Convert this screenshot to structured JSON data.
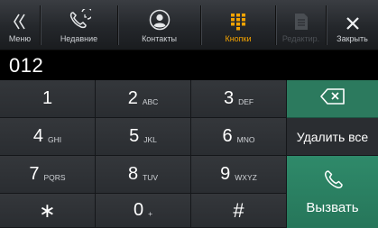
{
  "topbar": {
    "menu_label": "Меню",
    "recent_label": "Недавние",
    "contacts_label": "Контакты",
    "keypad_label": "Кнопки",
    "edit_label": "Редактир.",
    "close_label": "Закрыть",
    "active_color": "#f4a300"
  },
  "display": {
    "number": "012"
  },
  "keypad": {
    "keys": [
      {
        "digit": "1",
        "letters": ""
      },
      {
        "digit": "2",
        "letters": "ABC"
      },
      {
        "digit": "3",
        "letters": "DEF"
      },
      {
        "digit": "4",
        "letters": "GHI"
      },
      {
        "digit": "5",
        "letters": "JKL"
      },
      {
        "digit": "6",
        "letters": "MNO"
      },
      {
        "digit": "7",
        "letters": "PQRS"
      },
      {
        "digit": "8",
        "letters": "TUV"
      },
      {
        "digit": "9",
        "letters": "WXYZ"
      },
      {
        "digit": "∗",
        "letters": ""
      },
      {
        "digit": "0",
        "letters": "+"
      },
      {
        "digit": "#",
        "letters": ""
      }
    ]
  },
  "actions": {
    "delete_all_label": "Удалить все",
    "call_label": "Вызвать",
    "accent_color": "#2c7a5e"
  },
  "icons": {
    "menu": "chevron-double-left-icon",
    "recent": "phone-history-icon",
    "contacts": "contact-person-icon",
    "keypad": "keypad-grid-icon",
    "edit": "edit-document-icon",
    "close": "close-icon",
    "backspace": "backspace-icon",
    "call": "phone-icon"
  }
}
